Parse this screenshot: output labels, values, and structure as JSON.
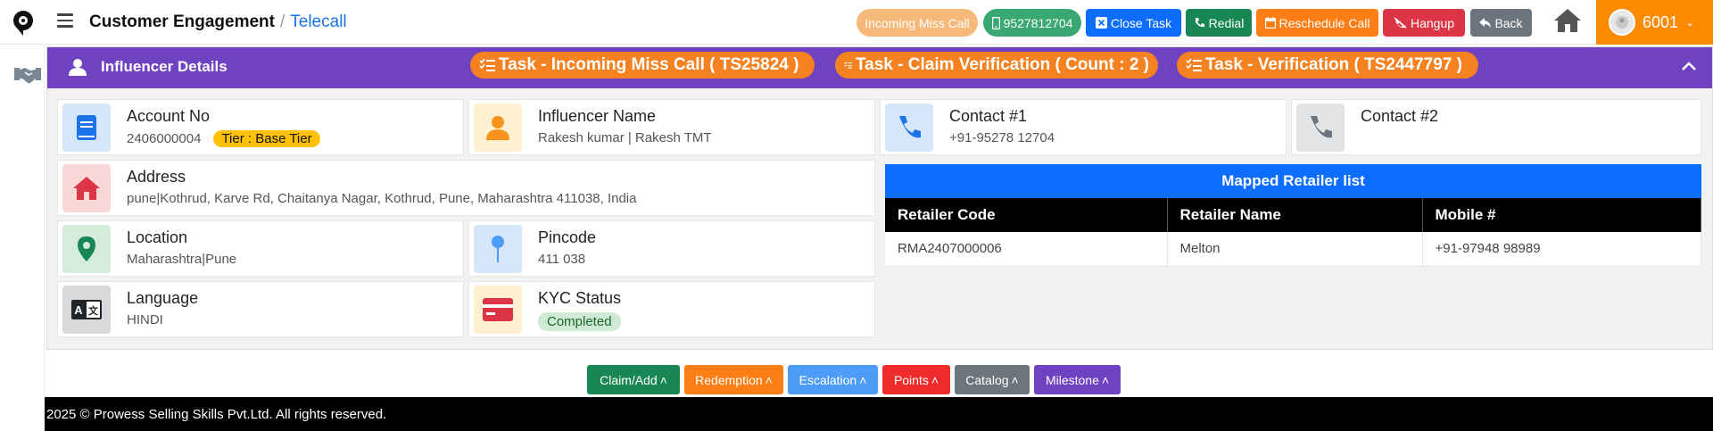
{
  "header": {
    "breadcrumb_main": "Customer Engagement",
    "breadcrumb_sep": "/",
    "breadcrumb_sub": "Telecall",
    "buttons": {
      "incoming_miss_call": "Incoming Miss Call",
      "phone": "9527812704",
      "close_task": "Close Task",
      "redial": "Redial",
      "reschedule": "Reschedule Call",
      "hangup": "Hangup",
      "back": "Back"
    },
    "user_id": "6001"
  },
  "card": {
    "title": "Influencer Details",
    "pills": [
      "Task - Incoming Miss Call ( TS25824 )",
      "Task - Claim Verification ( Count : 2 )",
      "Task - Verification ( TS2447797 )"
    ],
    "account": {
      "label": "Account No",
      "value": "2406000004",
      "tier": "Tier : Base Tier"
    },
    "influencer": {
      "label": "Influencer Name",
      "value": "Rakesh kumar | Rakesh TMT"
    },
    "contact1": {
      "label": "Contact #1",
      "value": "+91-95278 12704"
    },
    "contact2": {
      "label": "Contact #2",
      "value": ""
    },
    "address": {
      "label": "Address",
      "value": "pune|Kothrud, Karve Rd, Chaitanya Nagar, Kothrud, Pune, Maharashtra 411038, India"
    },
    "location": {
      "label": "Location",
      "value": "Maharashtra|Pune"
    },
    "pincode": {
      "label": "Pincode",
      "value": "411 038"
    },
    "language": {
      "label": "Language",
      "value": "HINDI"
    },
    "kyc": {
      "label": "KYC Status",
      "value": "Completed"
    }
  },
  "retailers": {
    "caption": "Mapped Retailer list",
    "columns": [
      "Retailer Code",
      "Retailer Name",
      "Mobile #"
    ],
    "rows": [
      [
        "RMA2407000006",
        "Melton",
        "+91-97948 98989"
      ]
    ]
  },
  "actions": [
    "Claim/Add",
    "Redemption",
    "Escalation",
    "Points",
    "Catalog",
    "Milestone"
  ],
  "footer": "2025 © Prowess Selling Skills Pvt.Ltd. All rights reserved.",
  "colors": {
    "header_purple": "#6f42c1",
    "pill_orange": "#f58220",
    "table_blue": "#0d6efd",
    "user_orange": "#fd8a00"
  },
  "icons": [
    "logo-pin-icon",
    "hamburger-icon",
    "phone-icon",
    "close-square-icon",
    "redial-icon",
    "calendar-icon",
    "hangup-icon",
    "back-icon",
    "home-icon",
    "avatar-icon",
    "handshake-icon",
    "person-icon",
    "tasks-icon",
    "chevron-up-icon",
    "book-icon",
    "user-icon",
    "map-marker-icon",
    "pin-icon",
    "language-icon",
    "credit-card-icon"
  ]
}
